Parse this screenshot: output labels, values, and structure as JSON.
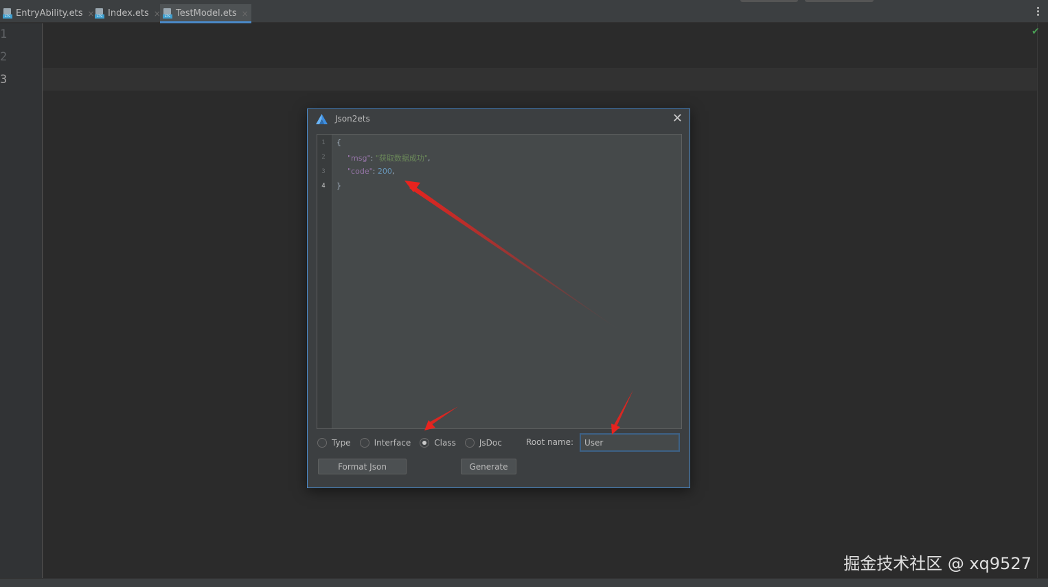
{
  "tabs": [
    {
      "label": "EntryAbility.ets",
      "active": false
    },
    {
      "label": "Index.ets",
      "active": false
    },
    {
      "label": "TestModel.ets",
      "active": true
    }
  ],
  "tab_close_glyph": "×",
  "editor": {
    "line_numbers": [
      "1",
      "2",
      "3"
    ],
    "current_line": "3",
    "status_icon": "check-icon"
  },
  "dialog": {
    "title": "Json2ets",
    "close_glyph": "✕",
    "json_editor": {
      "line_numbers": [
        "1",
        "2",
        "3",
        "4"
      ],
      "lines": {
        "l1": "{",
        "l2_key": "\"msg\"",
        "l2_colon": ": ",
        "l2_value": "\"获取数据成功\"",
        "l2_comma": ",",
        "l3_key": "\"code\"",
        "l3_colon": ": ",
        "l3_value": "200",
        "l3_comma": ",",
        "l4": "}"
      }
    },
    "options": [
      {
        "label": "Type",
        "selected": false
      },
      {
        "label": "Interface",
        "selected": false
      },
      {
        "label": "Class",
        "selected": true
      },
      {
        "label": "JsDoc",
        "selected": false
      }
    ],
    "root_name_label": "Root name:",
    "root_name_value": "User",
    "format_button": "Format Json",
    "generate_button": "Generate"
  },
  "watermark": "掘金技术社区 @ xq9527",
  "colors": {
    "accent": "#4a88c7",
    "annotation_arrow": "#e8231e",
    "json_key": "#9876aa",
    "json_string": "#6a8759",
    "json_number": "#6897bb"
  }
}
